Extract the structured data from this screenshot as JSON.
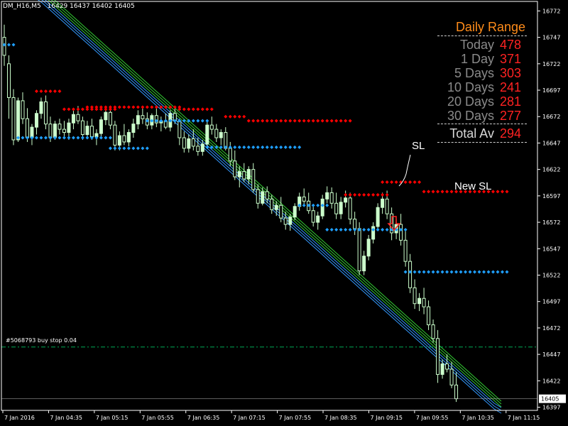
{
  "header": {
    "symbol": "DM_H16,M5",
    "ohlc": "16429 16437 16402 16405"
  },
  "order_label": "#5068793 buy stop 0.04",
  "daily_range": {
    "title": "Daily Range",
    "rows": [
      {
        "label": "Today",
        "value": "478"
      },
      {
        "label": "1 Day",
        "value": "371"
      },
      {
        "label": "5 Days",
        "value": "303"
      },
      {
        "label": "10 Days",
        "value": "241"
      },
      {
        "label": "20 Days",
        "value": "281"
      },
      {
        "label": "30 Days",
        "value": "277"
      }
    ],
    "total": {
      "label": "Total Av",
      "value": "294"
    }
  },
  "annotations": {
    "sl": "SL",
    "new_sl": "New SL"
  },
  "colors": {
    "background": "#000000",
    "bull_candle": "#ccffcc",
    "resistance_dots": "#ff0000",
    "support_dots": "#1fa0ff",
    "band_green": "#33cc33",
    "band_blue": "#3399ff",
    "order_line": "#00aa55",
    "axis": "#ffffff",
    "title_orange": "#ff8c1a",
    "value_red": "#ff2222"
  },
  "chart_data": {
    "type": "candlestick",
    "y_ticks": [
      "16772",
      "16747",
      "16722",
      "16697",
      "16672",
      "16647",
      "16622",
      "16597",
      "16572",
      "16547",
      "16522",
      "16497",
      "16472",
      "16447",
      "16422",
      "16397"
    ],
    "x_ticks": [
      "7 Jan 2016",
      "7 Jan 04:35",
      "7 Jan 05:15",
      "7 Jan 05:55",
      "7 Jan 06:35",
      "7 Jan 07:15",
      "7 Jan 07:55",
      "7 Jan 08:35",
      "7 Jan 09:15",
      "7 Jan 09:55",
      "7 Jan 10:35",
      "7 Jan 11:15"
    ],
    "ylim": [
      16394,
      16781
    ],
    "current_price": "16405",
    "order_line_price": 16454,
    "bar_count": 110,
    "candles": [
      [
        16747,
        16759,
        16720,
        16730
      ],
      [
        16722,
        16730,
        16670,
        16690
      ],
      [
        16690,
        16698,
        16645,
        16650
      ],
      [
        16650,
        16690,
        16648,
        16687
      ],
      [
        16687,
        16695,
        16665,
        16670
      ],
      [
        16670,
        16680,
        16648,
        16652
      ],
      [
        16652,
        16665,
        16645,
        16662
      ],
      [
        16662,
        16678,
        16655,
        16675
      ],
      [
        16675,
        16690,
        16670,
        16686
      ],
      [
        16686,
        16692,
        16660,
        16665
      ],
      [
        16665,
        16672,
        16648,
        16652
      ],
      [
        16652,
        16668,
        16650,
        16665
      ],
      [
        16665,
        16670,
        16655,
        16660
      ],
      [
        16660,
        16668,
        16652,
        16657
      ],
      [
        16657,
        16670,
        16650,
        16666
      ],
      [
        16666,
        16678,
        16660,
        16674
      ],
      [
        16674,
        16682,
        16665,
        16668
      ],
      [
        16668,
        16672,
        16650,
        16655
      ],
      [
        16655,
        16668,
        16652,
        16663
      ],
      [
        16663,
        16670,
        16650,
        16653
      ],
      [
        16653,
        16660,
        16645,
        16656
      ],
      [
        16656,
        16672,
        16652,
        16669
      ],
      [
        16669,
        16680,
        16664,
        16676
      ],
      [
        16676,
        16682,
        16660,
        16664
      ],
      [
        16664,
        16668,
        16640,
        16645
      ],
      [
        16645,
        16658,
        16640,
        16654
      ],
      [
        16654,
        16665,
        16645,
        16648
      ],
      [
        16648,
        16660,
        16644,
        16657
      ],
      [
        16657,
        16670,
        16652,
        16665
      ],
      [
        16665,
        16678,
        16660,
        16673
      ],
      [
        16673,
        16682,
        16665,
        16670
      ],
      [
        16670,
        16676,
        16660,
        16664
      ],
      [
        16664,
        16675,
        16660,
        16673
      ],
      [
        16673,
        16680,
        16662,
        16666
      ],
      [
        16666,
        16672,
        16658,
        16668
      ],
      [
        16668,
        16675,
        16660,
        16662
      ],
      [
        16662,
        16678,
        16658,
        16675
      ],
      [
        16675,
        16680,
        16665,
        16668
      ],
      [
        16668,
        16670,
        16645,
        16652
      ],
      [
        16652,
        16658,
        16638,
        16642
      ],
      [
        16642,
        16655,
        16638,
        16651
      ],
      [
        16651,
        16660,
        16640,
        16644
      ],
      [
        16644,
        16652,
        16635,
        16639
      ],
      [
        16639,
        16650,
        16635,
        16646
      ],
      [
        16646,
        16668,
        16644,
        16664
      ],
      [
        16664,
        16672,
        16655,
        16660
      ],
      [
        16660,
        16665,
        16648,
        16652
      ],
      [
        16652,
        16660,
        16645,
        16657
      ],
      [
        16657,
        16662,
        16640,
        16642
      ],
      [
        16642,
        16648,
        16625,
        16630
      ],
      [
        16630,
        16640,
        16612,
        16615
      ],
      [
        16615,
        16625,
        16605,
        16620
      ],
      [
        16620,
        16628,
        16610,
        16613
      ],
      [
        16613,
        16625,
        16608,
        16622
      ],
      [
        16622,
        16628,
        16600,
        16603
      ],
      [
        16603,
        16608,
        16585,
        16590
      ],
      [
        16590,
        16605,
        16588,
        16601
      ],
      [
        16601,
        16606,
        16590,
        16594
      ],
      [
        16594,
        16598,
        16580,
        16584
      ],
      [
        16584,
        16592,
        16578,
        16588
      ],
      [
        16588,
        16596,
        16572,
        16576
      ],
      [
        16576,
        16582,
        16565,
        16570
      ],
      [
        16570,
        16580,
        16564,
        16577
      ],
      [
        16577,
        16590,
        16574,
        16587
      ],
      [
        16587,
        16600,
        16583,
        16596
      ],
      [
        16596,
        16604,
        16588,
        16592
      ],
      [
        16592,
        16600,
        16580,
        16583
      ],
      [
        16583,
        16588,
        16568,
        16572
      ],
      [
        16572,
        16582,
        16565,
        16578
      ],
      [
        16578,
        16598,
        16575,
        16594
      ],
      [
        16594,
        16606,
        16590,
        16600
      ],
      [
        16600,
        16605,
        16585,
        16590
      ],
      [
        16590,
        16600,
        16575,
        16580
      ],
      [
        16580,
        16596,
        16575,
        16591
      ],
      [
        16591,
        16602,
        16586,
        16595
      ],
      [
        16595,
        16600,
        16570,
        16575
      ],
      [
        16575,
        16582,
        16560,
        16566
      ],
      [
        16566,
        16572,
        16522,
        16526
      ],
      [
        16526,
        16545,
        16522,
        16540
      ],
      [
        16540,
        16560,
        16536,
        16556
      ],
      [
        16556,
        16572,
        16552,
        16568
      ],
      [
        16568,
        16590,
        16564,
        16586
      ],
      [
        16586,
        16600,
        16580,
        16594
      ],
      [
        16594,
        16602,
        16575,
        16580
      ],
      [
        16580,
        16586,
        16555,
        16562
      ],
      [
        16562,
        16575,
        16556,
        16570
      ],
      [
        16570,
        16580,
        16550,
        16555
      ],
      [
        16555,
        16565,
        16530,
        16535
      ],
      [
        16535,
        16542,
        16505,
        16510
      ],
      [
        16510,
        16518,
        16490,
        16495
      ],
      [
        16495,
        16505,
        16488,
        16500
      ],
      [
        16500,
        16510,
        16485,
        16492
      ],
      [
        16492,
        16498,
        16470,
        16475
      ],
      [
        16475,
        16480,
        16458,
        16462
      ],
      [
        16462,
        16470,
        16420,
        16428
      ],
      [
        16428,
        16442,
        16424,
        16438
      ],
      [
        16438,
        16447,
        16430,
        16433
      ],
      [
        16433,
        16440,
        16415,
        16418
      ],
      [
        16418,
        16430,
        16402,
        16405
      ]
    ],
    "series": [
      {
        "type": "band",
        "color": "green",
        "values": [
          16800,
          16795,
          16790,
          16784,
          16778,
          16772,
          16766,
          16760,
          16754,
          16748,
          16742,
          16736,
          16730,
          16724,
          16718,
          16712,
          16706,
          16700,
          16694,
          16688,
          16682,
          16676,
          16670,
          16664,
          16658,
          16652,
          16646,
          16640,
          16634,
          16628,
          16622,
          16616,
          16610,
          16604,
          16598,
          16592,
          16586,
          16580,
          16574,
          16568,
          16562,
          16556,
          16550,
          16544,
          16538,
          16532,
          16526,
          16520,
          16514,
          16508,
          16502,
          16496,
          16490,
          16484,
          16478,
          16472,
          16466,
          16460,
          16454,
          16448,
          16442,
          16436,
          16430,
          16424,
          16418,
          16412,
          16406,
          16400
        ]
      },
      {
        "type": "band",
        "color": "blue",
        "values": [
          16792,
          16787,
          16782,
          16776,
          16770,
          16764,
          16758,
          16752,
          16746,
          16740,
          16734,
          16728,
          16722,
          16716,
          16710,
          16704,
          16698,
          16692,
          16686,
          16680,
          16674,
          16668,
          16662,
          16656,
          16650,
          16644,
          16638,
          16632,
          16626,
          16620,
          16614,
          16608,
          16602,
          16596,
          16590,
          16584,
          16578,
          16572,
          16566,
          16560,
          16554,
          16548,
          16542,
          16536,
          16530,
          16524,
          16518,
          16512,
          16506,
          16500,
          16494,
          16488,
          16482,
          16476,
          16470,
          16464,
          16458,
          16452,
          16446,
          16440,
          16434,
          16428,
          16422,
          16416,
          16410,
          16404,
          16398,
          16394
        ]
      },
      {
        "type": "dots",
        "color": "red",
        "segments": [
          {
            "from": 7,
            "to": 12,
            "value": 16696
          },
          {
            "from": 13,
            "to": 24,
            "value": 16679
          },
          {
            "from": 18,
            "to": 38,
            "value": 16681
          },
          {
            "from": 38,
            "to": 45,
            "value": 16679
          },
          {
            "from": 48,
            "to": 52,
            "value": 16672
          },
          {
            "from": 53,
            "to": 75,
            "value": 16668
          },
          {
            "from": 74,
            "to": 83,
            "value": 16598
          },
          {
            "from": 82,
            "to": 90,
            "value": 16610
          },
          {
            "from": 91,
            "to": 109,
            "value": 16601
          }
        ]
      },
      {
        "type": "dots",
        "color": "blue",
        "segments": [
          {
            "from": 0,
            "to": 2,
            "value": 16740
          },
          {
            "from": 3,
            "to": 23,
            "value": 16652
          },
          {
            "from": 23,
            "to": 31,
            "value": 16642
          },
          {
            "from": 31,
            "to": 44,
            "value": 16668
          },
          {
            "from": 44,
            "to": 64,
            "value": 16643
          },
          {
            "from": 64,
            "to": 70,
            "value": 16588
          },
          {
            "from": 70,
            "to": 87,
            "value": 16565
          },
          {
            "from": 87,
            "to": 109,
            "value": 16525
          }
        ]
      }
    ]
  }
}
